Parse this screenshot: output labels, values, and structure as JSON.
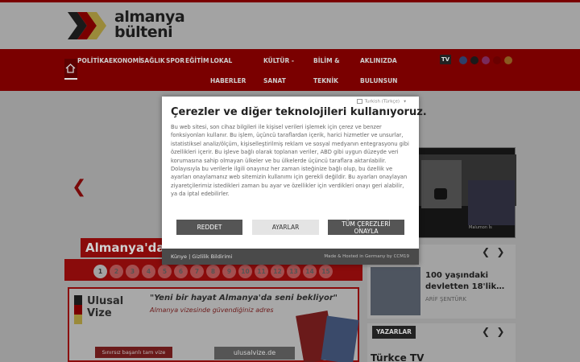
{
  "site": {
    "logo_line1": "almanya",
    "logo_line2": "bülteni"
  },
  "nav": {
    "items": [
      "POLİTİKA",
      "EKONOMİ",
      "SAĞLIK",
      "SPOR",
      "EĞİTİM",
      "LOKAL",
      "HABERLER",
      "KÜLTÜR -",
      "SANAT",
      "BİLİM &",
      "TEKNİK",
      "AKLINIZDA",
      "BULUNSUN"
    ],
    "tv_label": "TV"
  },
  "featured": {
    "label": "Almanya'da",
    "video_caption": "Malumon İs"
  },
  "pagination": {
    "pages": [
      "1",
      "2",
      "3",
      "4",
      "5",
      "6",
      "7",
      "8",
      "9",
      "10",
      "11",
      "12",
      "13",
      "14",
      "15"
    ],
    "active": "1"
  },
  "ad": {
    "brand_line1": "Ulusal",
    "brand_line2": "Vize",
    "slogan": "\"Yeni bir hayat Almanya'da seni bekliyor\"",
    "subline": "Almanya vizesinde güvendiğiniz adres",
    "button": "Sınırsız başarılı tam vize",
    "domain": "ulusalvize.de"
  },
  "news": {
    "title": "100 yaşındaki devletten 18'lik…",
    "author": "ARİF ŞENTÜRK"
  },
  "writers": {
    "label": "YAZARLAR",
    "turkce_tv": "Türkce TV"
  },
  "cookie": {
    "language": "Turkish (Türkçe)",
    "title": "Çerezler ve diğer teknolojileri kullanıyoruz.",
    "body": "Bu web sitesi, son cihaz bilgileri ile kişisel verileri işlemek için çerez ve benzer fonksiyonları kullanır. Bu işlem, üçüncü taraflardan içerik, harici hizmetler ve unsurlar, istatistiksel analiz/ölçüm, kişiselleştirilmiş reklam ve sosyal medyanın entegrasyonu gibi özellikleri içerir. Bu işleve bağlı olarak toplanan veriler, ABD gibi uygun düzeyde veri korumasına sahip olmayan ülkeler ve bu ülkelerde üçüncü taraflara aktarılabilir. Dolayısıyla bu verilerle ilgili onayınız her zaman isteğinize bağlı olup, bu özellik ve ayarları onaylamanız web sitemizin kullanımı için gerekli değildir. Bu ayarları onaylayan ziyaretçilerimiz istedikleri zaman bu ayar ve özellikler için verdikleri onayı geri alabilir, ya da iptal edebilirler.",
    "reject_label": "REDDET",
    "settings_label": "AYARLAR",
    "accept_label_line1": "TÜM ÇEREZLERİ",
    "accept_label_line2": "ONAYLA",
    "footer_links": "Künye | Gizlilik Bildirimi",
    "footer_credit": "Made & Hosted in Germany by CCM19"
  },
  "colors": {
    "brand_red": "#c40000",
    "dark_button": "#555555"
  }
}
